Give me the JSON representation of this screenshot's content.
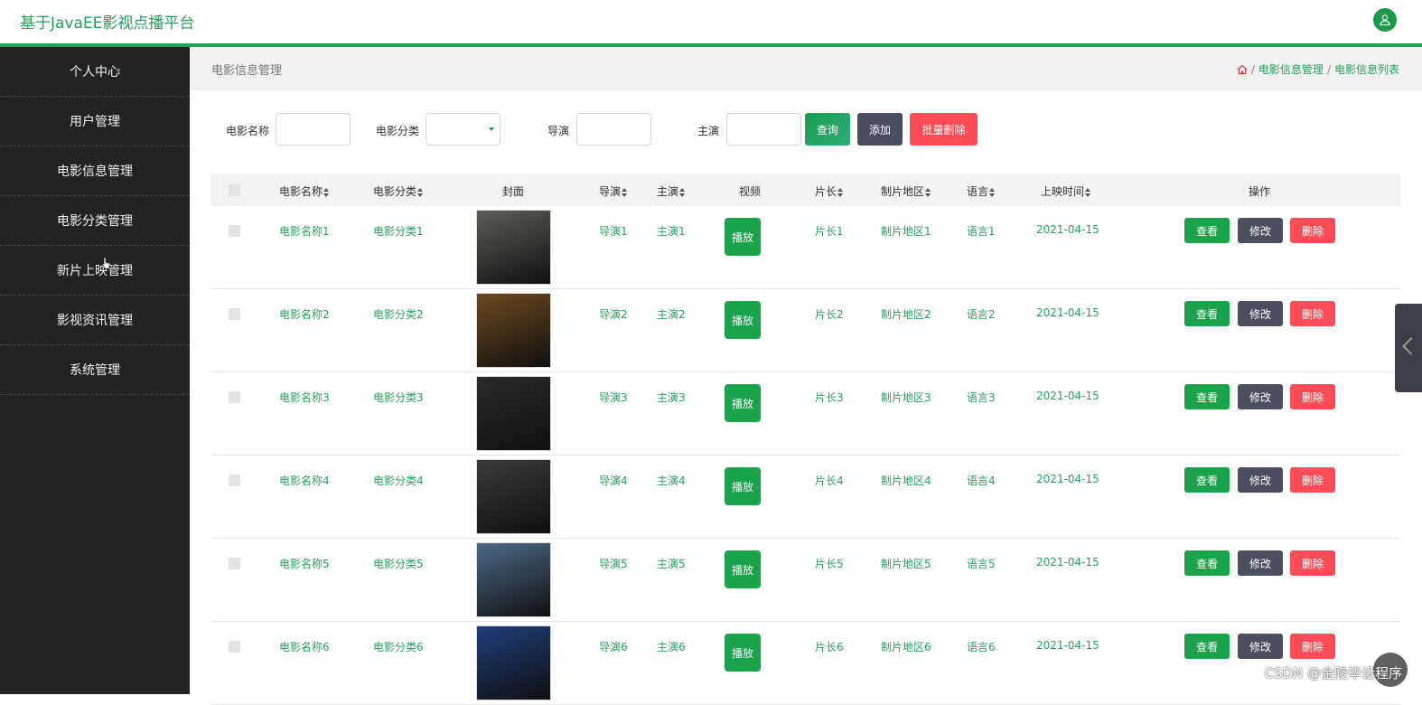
{
  "app": {
    "title": "基于JavaEE影视点播平台"
  },
  "sidebar": {
    "items": [
      {
        "label": "个人中心"
      },
      {
        "label": "用户管理"
      },
      {
        "label": "电影信息管理"
      },
      {
        "label": "电影分类管理"
      },
      {
        "label": "新片上映管理"
      },
      {
        "label": "影视资讯管理"
      },
      {
        "label": "系统管理"
      }
    ]
  },
  "page": {
    "title": "电影信息管理",
    "breadcrumb": [
      "电影信息管理",
      "电影信息列表"
    ]
  },
  "search": {
    "name_label": "电影名称",
    "category_label": "电影分类",
    "director_label": "导演",
    "actor_label": "主演",
    "query_button": "查询",
    "add_button": "添加",
    "batch_delete_button": "批量删除"
  },
  "table": {
    "headers": {
      "name": "电影名称",
      "category": "电影分类",
      "cover": "封面",
      "director": "导演",
      "actor": "主演",
      "video": "视频",
      "duration": "片长",
      "region": "制片地区",
      "language": "语言",
      "release": "上映时间",
      "actions": "操作"
    },
    "play_label": "播放",
    "view_label": "查看",
    "edit_label": "修改",
    "delete_label": "删除",
    "rows": [
      {
        "name": "电影名称1",
        "category": "电影分类1",
        "director": "导演1",
        "actor": "主演1",
        "duration": "片长1",
        "region": "制片地区1",
        "language": "语言1",
        "release": "2021-04-15",
        "cover_color": "#5b5e57"
      },
      {
        "name": "电影名称2",
        "category": "电影分类2",
        "director": "导演2",
        "actor": "主演2",
        "duration": "片长2",
        "region": "制片地区2",
        "language": "语言2",
        "release": "2021-04-15",
        "cover_color": "#6b4a1f"
      },
      {
        "name": "电影名称3",
        "category": "电影分类3",
        "director": "导演3",
        "actor": "主演3",
        "duration": "片长3",
        "region": "制片地区3",
        "language": "语言3",
        "release": "2021-04-15",
        "cover_color": "#2b2b2b"
      },
      {
        "name": "电影名称4",
        "category": "电影分类4",
        "director": "导演4",
        "actor": "主演4",
        "duration": "片长4",
        "region": "制片地区4",
        "language": "语言4",
        "release": "2021-04-15",
        "cover_color": "#3a3a3a"
      },
      {
        "name": "电影名称5",
        "category": "电影分类5",
        "director": "导演5",
        "actor": "主演5",
        "duration": "片长5",
        "region": "制片地区5",
        "language": "语言5",
        "release": "2021-04-15",
        "cover_color": "#4d6a85"
      },
      {
        "name": "电影名称6",
        "category": "电影分类6",
        "director": "导演6",
        "actor": "主演6",
        "duration": "片长6",
        "region": "制片地区6",
        "language": "语言6",
        "release": "2021-04-15",
        "cover_color": "#1f3d7a"
      }
    ]
  },
  "watermark": "CSDN @金陵毕设程序"
}
